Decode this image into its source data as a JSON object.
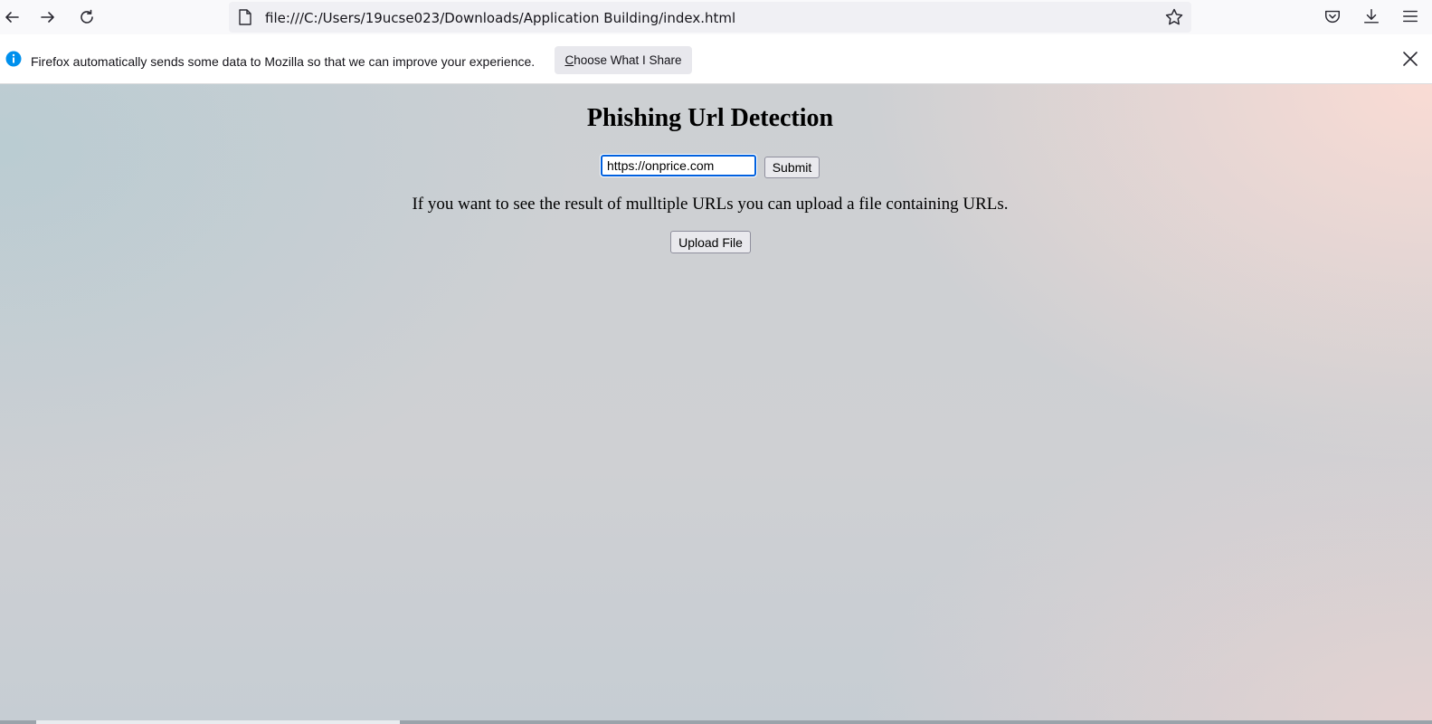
{
  "browser": {
    "url": "file:///C:/Users/19ucse023/Downloads/Application Building/index.html",
    "icons": {
      "back": "back-arrow-icon",
      "forward": "forward-arrow-icon",
      "reload": "reload-icon",
      "page": "page-icon",
      "bookmark": "star-icon",
      "pocket": "pocket-icon",
      "downloads": "download-icon",
      "menu": "hamburger-menu-icon"
    }
  },
  "notification": {
    "text": "Firefox automatically sends some data to Mozilla so that we can improve your experience.",
    "button_first": "C",
    "button_rest": "hoose What I Share",
    "icons": {
      "info": "info-icon",
      "close": "close-icon"
    }
  },
  "page": {
    "title": "Phishing Url Detection",
    "url_input_value": "https://onprice.com",
    "submit_label": "Submit",
    "description": "If you want to see the result of mulltiple URLs you can upload a file containing URLs.",
    "upload_label": "Upload File"
  },
  "colors": {
    "accent": "#0060df",
    "info": "#0090ed"
  }
}
